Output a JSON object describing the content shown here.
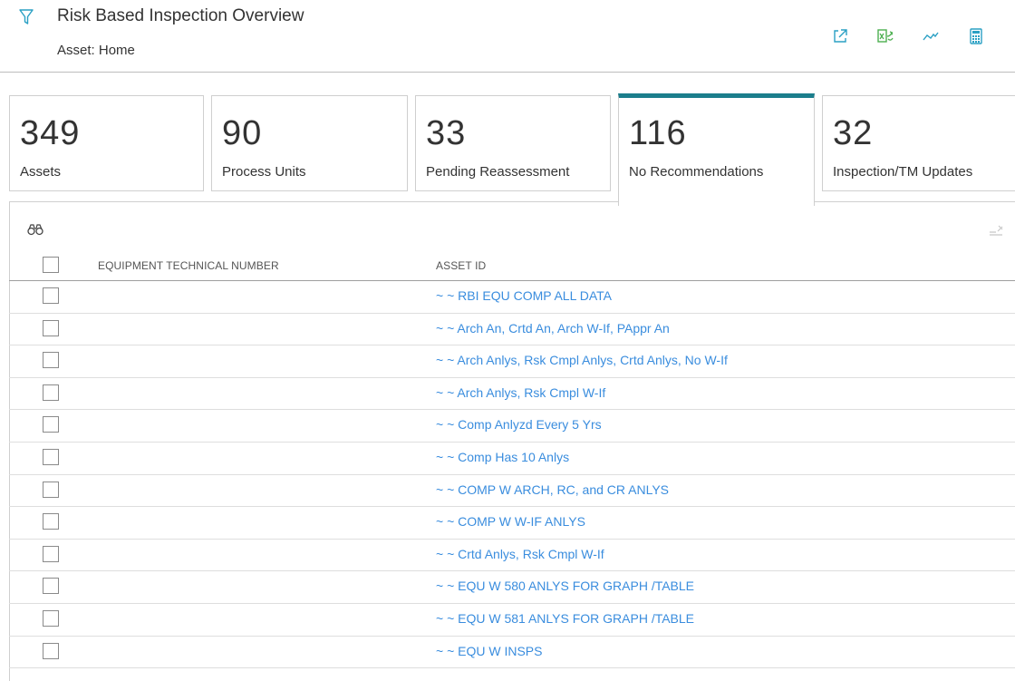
{
  "header": {
    "title": "Risk Based Inspection Overview",
    "asset_label": "Asset:",
    "asset_value": "Home"
  },
  "toolbar": {
    "icons": [
      "open-external-icon",
      "export-excel-icon",
      "trend-icon",
      "calculator-icon"
    ]
  },
  "cards": [
    {
      "count": "349",
      "label": "Assets"
    },
    {
      "count": "90",
      "label": "Process Units"
    },
    {
      "count": "33",
      "label": "Pending Reassessment"
    },
    {
      "count": "116",
      "label": "No Recommendations"
    },
    {
      "count": "32",
      "label": "Inspection/TM Updates"
    }
  ],
  "table": {
    "columns": [
      "EQUIPMENT TECHNICAL NUMBER",
      "ASSET ID"
    ],
    "rows": [
      "~ ~ RBI EQU COMP ALL DATA",
      "~ ~ Arch An, Crtd An, Arch W-If, PAppr An",
      "~ ~ Arch Anlys, Rsk Cmpl Anlys, Crtd Anlys, No W-If",
      "~ ~ Arch Anlys, Rsk Cmpl W-If",
      "~ ~ Comp Anlyzd Every 5 Yrs",
      "~ ~ Comp Has 10 Anlys",
      "~ ~ COMP W ARCH, RC, and CR ANLYS",
      "~ ~ COMP W W-IF ANLYS",
      "~ ~ Crtd Anlys, Rsk Cmpl W-If",
      "~ ~ EQU W 580 ANLYS FOR GRAPH /TABLE",
      "~ ~ EQU W 581 ANLYS FOR GRAPH /TABLE",
      "~ ~ EQU W INSPS"
    ]
  },
  "colors": {
    "accent": "#1b7e8c",
    "link": "#3a8dde",
    "icon": "#2aa0c4",
    "excel": "#4caf50"
  }
}
